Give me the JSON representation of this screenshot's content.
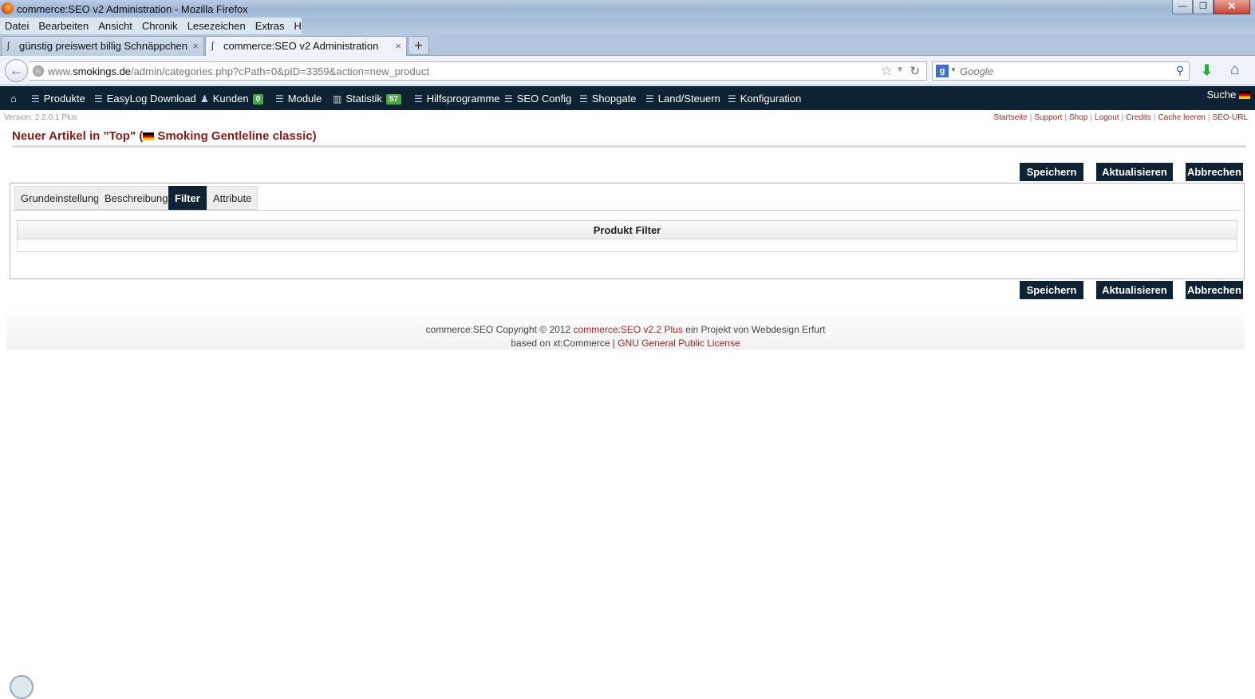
{
  "window": {
    "title": "commerce:SEO v2 Administration - Mozilla Firefox",
    "min": "—",
    "max": "❐",
    "close": "✕"
  },
  "menu": [
    "Datei",
    "Bearbeiten",
    "Ansicht",
    "Chronik",
    "Lesezeichen",
    "Extras",
    "Hilfe"
  ],
  "tabs": [
    {
      "label": "günstig preiswert billig Schnäppchen ...",
      "close": "×"
    },
    {
      "label": "commerce:SEO v2 Administration",
      "close": "×"
    }
  ],
  "newtab": "+",
  "nav": {
    "url_host": "www.",
    "url_domain": "smokings.de",
    "url_path": "/admin/categories.php?cPath=0&pID=3359&action=new_product",
    "search_placeholder": "Google"
  },
  "adminnav": {
    "items": [
      {
        "label": "Produkte"
      },
      {
        "label": "EasyLog Download"
      },
      {
        "label": "Kunden",
        "badge": "0"
      },
      {
        "label": "Module"
      },
      {
        "label": "Statistik",
        "badge": "57"
      },
      {
        "label": "Hilfsprogramme"
      },
      {
        "label": "SEO Config"
      },
      {
        "label": "Shopgate"
      },
      {
        "label": "Land/Steuern"
      },
      {
        "label": "Konfiguration"
      }
    ],
    "search_label": "Suche"
  },
  "version": "Version: 2.2.0.1 Plus",
  "toplinks": [
    "Startseite",
    "Support",
    "Shop",
    "Logout",
    "Credits",
    "Cache leeren",
    "SEO-URL"
  ],
  "page": {
    "title_pre": "Neuer Artikel in \"Top\" (",
    "title_post": " Smoking Gentleline classic)"
  },
  "buttons": {
    "save": "Speichern",
    "update": "Aktualisieren",
    "cancel": "Abbrechen"
  },
  "form_tabs": [
    "Grundeinstellung",
    "Beschreibung",
    "Filter",
    "Attribute"
  ],
  "active_tab": "Filter",
  "filter": {
    "heading": "Produkt Filter"
  },
  "footer": {
    "line1_pre": "commerce:SEO Copyright © 2012 ",
    "line1_link": "commerce:SEO v2.2 Plus",
    "line1_post": " ein Projekt von Webdesign Erfurt",
    "line2_pre": "based on xt:Commerce | ",
    "line2_link": "GNU General Public License"
  },
  "colors": {
    "nav_bg": "#0f2233",
    "accent_red": "#8b1a16",
    "badge_green": "#4ca64c"
  }
}
